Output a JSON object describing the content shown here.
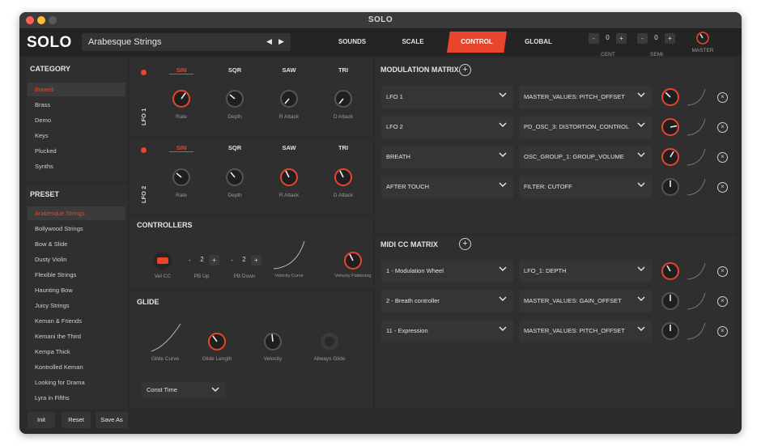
{
  "window": {
    "title": "SOLO"
  },
  "header": {
    "logo": "SOLO",
    "preset": "Arabesque Strings",
    "tabs": [
      {
        "label": "SOUNDS",
        "active": false
      },
      {
        "label": "SCALE",
        "active": false
      },
      {
        "label": "CONTROL",
        "active": true
      },
      {
        "label": "GLOBAL",
        "active": false
      }
    ],
    "cent": {
      "label": "CENT",
      "value": "0",
      "minus": "-",
      "plus": "+"
    },
    "semi": {
      "label": "SEMI",
      "value": "0",
      "minus": "-",
      "plus": "+"
    },
    "master": {
      "label": "MASTER"
    }
  },
  "sidebar": {
    "category_title": "CATEGORY",
    "categories": [
      "Bowed",
      "Brass",
      "Demo",
      "Keys",
      "Plucked",
      "Synths"
    ],
    "preset_title": "PRESET",
    "presets": [
      "Arabesque Strings",
      "Bollywood Strings",
      "Bow & Slide",
      "Dusty Violin",
      "Flexible Strings",
      "Haunting Bow",
      "Juicy Strings",
      "Keman & Friends",
      "Kemani the Third",
      "Kempa Thick",
      "Kontrolled Keman",
      "Looking for Drama",
      "Lyra in Fifths"
    ],
    "buttons": {
      "init": "Init",
      "reset": "Reset",
      "save_as": "Save As"
    }
  },
  "lfo1": {
    "label": "LFO 1",
    "waves": [
      "SIN",
      "SQR",
      "SAW",
      "TRI"
    ],
    "knobs": [
      "Rate",
      "Depth",
      "R Attack",
      "D Attack"
    ]
  },
  "lfo2": {
    "label": "LFO 2",
    "waves": [
      "SIN",
      "SQR",
      "SAW",
      "TRI"
    ],
    "knobs": [
      "Rate",
      "Depth",
      "R Attack",
      "D Attack"
    ]
  },
  "controllers": {
    "title": "CONTROLLERS",
    "vel_cc": "Vel CC",
    "pb_up": {
      "label": "PB Up",
      "value": "2",
      "minus": "-",
      "plus": "+"
    },
    "pb_down": {
      "label": "PB Down",
      "value": "2",
      "minus": "-",
      "plus": "+"
    },
    "velocity_curve": "Velocity Curve",
    "velocity_flattening": "Velocity Flattening"
  },
  "glide": {
    "title": "GLIDE",
    "curve": "Glide Curve",
    "length": "Glide Length",
    "velocity": "Velocity",
    "always": "Allways Glide",
    "mode": "Const Time"
  },
  "mod_matrix": {
    "title": "MODULATION MATRIX",
    "rows": [
      {
        "source": "LFO 1",
        "target": "MASTER_VALUES: PITCH_OFFSET"
      },
      {
        "source": "LFO 2",
        "target": "PD_OSC_3: DISTORTION_CONTROL"
      },
      {
        "source": "BREATH",
        "target": "OSC_GROUP_1: GROUP_VOLUME"
      },
      {
        "source": "AFTER TOUCH",
        "target": "FILTER: CUTOFF"
      }
    ]
  },
  "midi_matrix": {
    "title": "MIDI CC MATRIX",
    "rows": [
      {
        "source": "1 - Modulation Wheel",
        "target": "LFO_1: DEPTH"
      },
      {
        "source": "2 - Breath controller",
        "target": "MASTER_VALUES: GAIN_OFFSET"
      },
      {
        "source": "11 - Expression",
        "target": "MASTER_VALUES: PITCH_OFFSET"
      }
    ]
  },
  "colors": {
    "accent": "#e8452c",
    "background": "#2b2b2b",
    "panel": "#2f2f2f"
  }
}
